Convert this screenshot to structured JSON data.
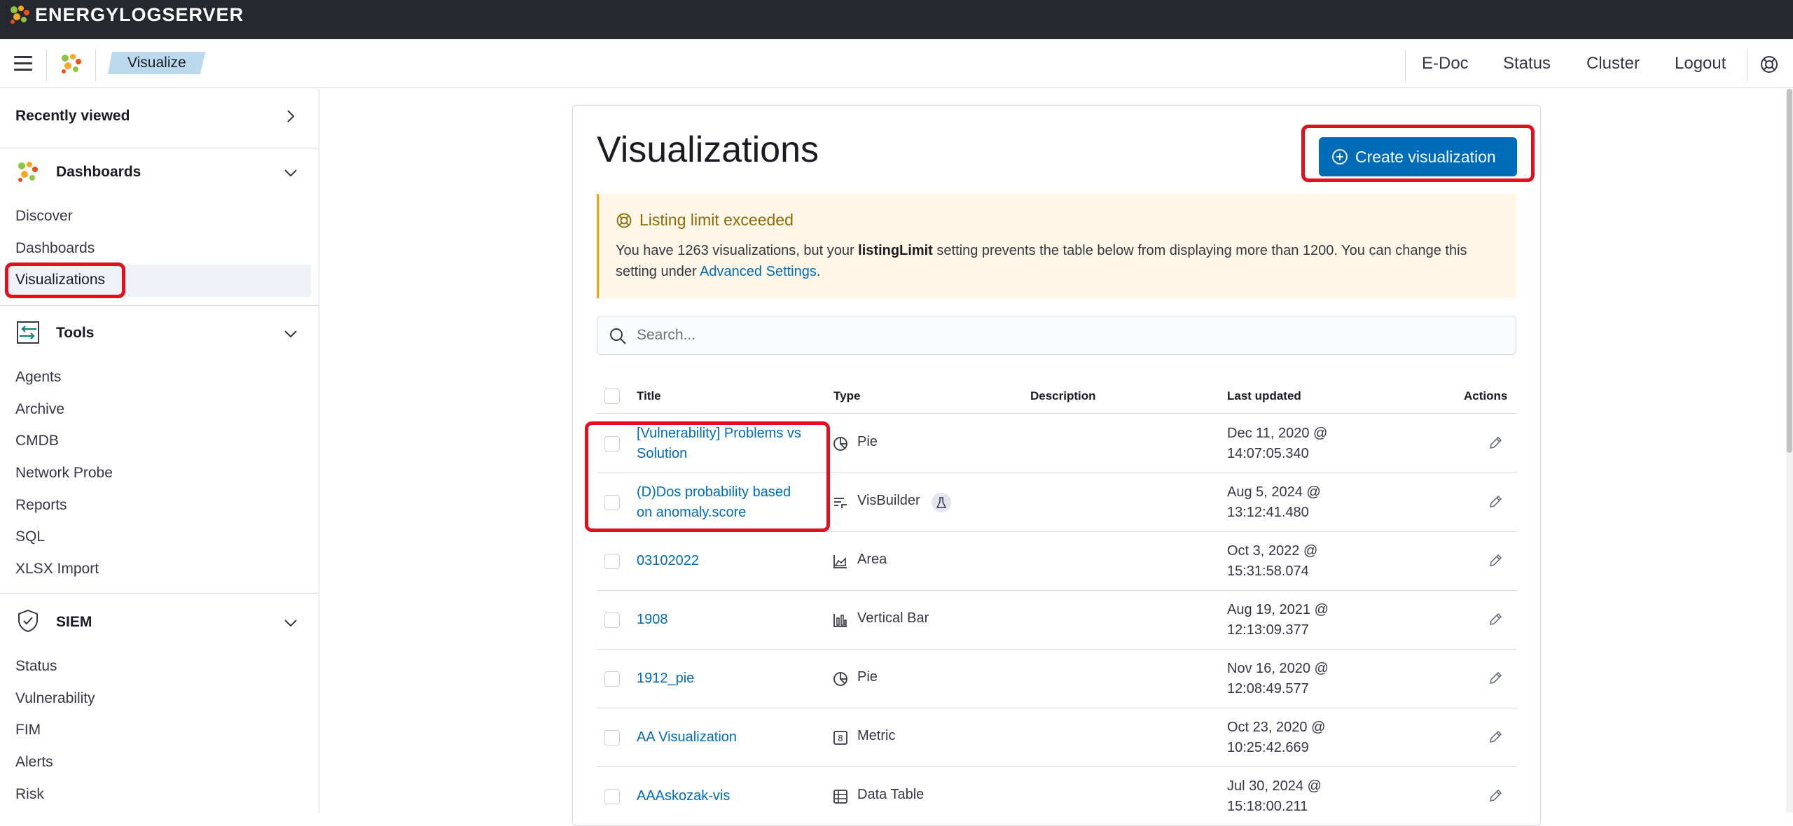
{
  "brand": {
    "name": "ENERGYLOGSERVER"
  },
  "header": {
    "breadcrumb": "Visualize",
    "nav": [
      "E-Doc",
      "Status",
      "Cluster",
      "Logout"
    ]
  },
  "sidebar": {
    "recently_viewed": "Recently viewed",
    "dashboards": {
      "title": "Dashboards",
      "items": [
        "Discover",
        "Dashboards",
        "Visualizations"
      ]
    },
    "tools": {
      "title": "Tools",
      "items": [
        "Agents",
        "Archive",
        "CMDB",
        "Network Probe",
        "Reports",
        "SQL",
        "XLSX Import"
      ]
    },
    "siem": {
      "title": "SIEM",
      "items": [
        "Status",
        "Vulnerability",
        "FIM",
        "Alerts",
        "Risk"
      ]
    }
  },
  "main": {
    "title": "Visualizations",
    "create_button": "Create visualization",
    "callout": {
      "title": "Listing limit exceeded",
      "text_1": "You have 1263 visualizations, but your ",
      "bold": "listingLimit",
      "text_2": " setting prevents the table below from displaying more than 1200. You can change this setting under ",
      "link": "Advanced Settings",
      "text_3": "."
    },
    "search": {
      "placeholder": "Search..."
    },
    "columns": {
      "title": "Title",
      "type": "Type",
      "description": "Description",
      "last_updated": "Last updated",
      "actions": "Actions"
    },
    "rows": [
      {
        "title_1": "[Vulnerability] Problems vs",
        "title_2": "Solution",
        "type": "Pie",
        "icon": "pie-icon",
        "updated_1": "Dec 11, 2020 @",
        "updated_2": "14:07:05.340"
      },
      {
        "title_1": "(D)Dos probability based",
        "title_2": "on anomaly.score",
        "type": "VisBuilder",
        "icon": "visbuilder-icon",
        "experimental": true,
        "updated_1": "Aug 5, 2024 @",
        "updated_2": "13:12:41.480"
      },
      {
        "title_1": "03102022",
        "title_2": "",
        "type": "Area",
        "icon": "area-chart-icon",
        "updated_1": "Oct 3, 2022 @",
        "updated_2": "15:31:58.074"
      },
      {
        "title_1": "1908",
        "title_2": "",
        "type": "Vertical Bar",
        "icon": "bar-chart-icon",
        "updated_1": "Aug 19, 2021 @",
        "updated_2": "12:13:09.377"
      },
      {
        "title_1": "1912_pie",
        "title_2": "",
        "type": "Pie",
        "icon": "pie-icon",
        "updated_1": "Nov 16, 2020 @",
        "updated_2": "12:08:49.577"
      },
      {
        "title_1": "AA Visualization",
        "title_2": "",
        "type": "Metric",
        "icon": "metric-icon",
        "updated_1": "Oct 23, 2020 @",
        "updated_2": "10:25:42.669"
      },
      {
        "title_1": "AAAskozak-vis",
        "title_2": "",
        "type": "Data Table",
        "icon": "table-icon",
        "updated_1": "Jul 30, 2024 @",
        "updated_2": "15:18:00.211"
      }
    ]
  },
  "colors": {
    "accent": "#006bb8",
    "annotation": "#e0101e",
    "topbar": "#25282f",
    "callout_bg": "#fef6e6"
  }
}
